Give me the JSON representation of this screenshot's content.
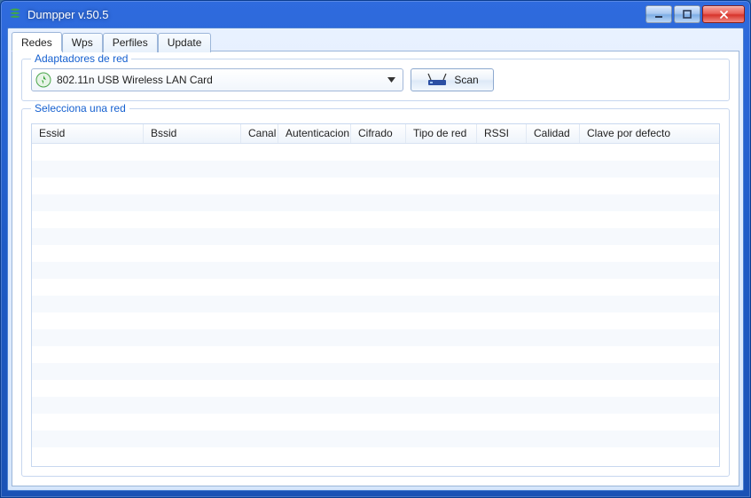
{
  "window": {
    "title": "Dumpper v.50.5"
  },
  "tabs": {
    "redes": "Redes",
    "wps": "Wps",
    "perfiles": "Perfiles",
    "update": "Update"
  },
  "adapters": {
    "group_label": "Adaptadores de red",
    "selected": "802.11n USB Wireless LAN Card",
    "scan_label": "Scan"
  },
  "networks": {
    "group_label": "Selecciona una red",
    "columns": {
      "essid": "Essid",
      "bssid": "Bssid",
      "canal": "Canal",
      "autenticacion": "Autenticacion",
      "cifrado": "Cifrado",
      "tipo": "Tipo de red",
      "rssi": "RSSI",
      "calidad": "Calidad",
      "clave": "Clave por defecto"
    },
    "rows": []
  }
}
